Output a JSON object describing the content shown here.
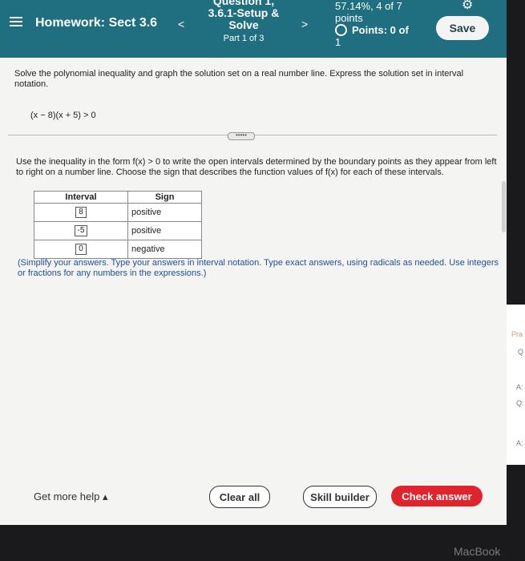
{
  "header": {
    "homework_title": "Homework: Sect 3.6",
    "question_title": "Question 1, 3.6.1-Setup & Solve",
    "part": "Part 1 of 3",
    "score_line1": "57.14%, 4 of 7",
    "score_line2": "points",
    "points": "Points: 0 of",
    "points_total": "1",
    "save_label": "Save",
    "prev_label": "<",
    "next_label": ">",
    "colors": {
      "bar": "#1f6f80",
      "check": "#e0242e"
    }
  },
  "problem": {
    "instruction": "Solve the polynomial inequality and graph the solution set on a real number line. Express the solution set in interval notation.",
    "inequality": "(x − 8)(x + 5) > 0",
    "step_instruction": "Use the inequality in the form f(x) > 0 to write the open intervals determined by the boundary points as they appear from left to right on a number line. Choose the sign that describes the function values of f(x) for each of these intervals.",
    "expand_label": "•••••",
    "table": {
      "headers": [
        "Interval",
        "Sign"
      ],
      "rows": [
        {
          "interval": "8",
          "sign": "positive"
        },
        {
          "interval": "-5",
          "sign": "positive"
        },
        {
          "interval": "0",
          "sign": "negative"
        }
      ]
    },
    "note": "(Simplify your answers. Type your answers in interval notation. Type exact answers, using radicals as needed. Use integers or fractions for any numbers in the expressions.)"
  },
  "footer": {
    "help_label": "Get more help ▴",
    "clear_label": "Clear all",
    "skill_label": "Skill builder",
    "check_label": "Check answer"
  },
  "side": {
    "text1": "Pra",
    "text2": "Q",
    "text3": "A:",
    "text4": "Q:",
    "text5": "A:"
  },
  "brand": "MacBook"
}
